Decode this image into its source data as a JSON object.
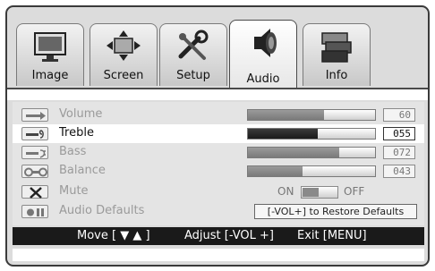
{
  "tabs": [
    {
      "label": "Image",
      "icon": "monitor-icon"
    },
    {
      "label": "Screen",
      "icon": "screen-arrows-icon"
    },
    {
      "label": "Setup",
      "icon": "tools-icon"
    },
    {
      "label": "Audio",
      "icon": "speaker-icon",
      "active": true
    },
    {
      "label": "Info",
      "icon": "info-boxes-icon"
    }
  ],
  "audio": {
    "rows": [
      {
        "label": "Volume",
        "value": "60",
        "level": 0.6
      },
      {
        "label": "Treble",
        "value": "055",
        "level": 0.55,
        "selected": true
      },
      {
        "label": "Bass",
        "value": "072",
        "level": 0.72
      },
      {
        "label": "Balance",
        "value": "043",
        "level": 0.43
      }
    ],
    "mute": {
      "label": "Mute",
      "on": "ON",
      "off": "OFF",
      "state": "on"
    },
    "defaults": {
      "label": "Audio Defaults",
      "hint": "[-VOL+] to Restore Defaults"
    }
  },
  "help": {
    "move": "Move [ ▼ ▲ ]",
    "adjust": "Adjust [-VOL +]",
    "exit": "Exit [MENU]"
  },
  "colors": {
    "selected_text": "#111111",
    "dim_text": "#9a9a9a",
    "help_bar": "#1a1a1a"
  }
}
